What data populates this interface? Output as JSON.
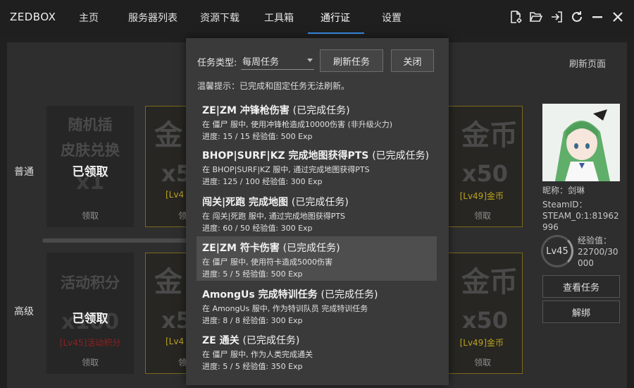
{
  "app": {
    "logo": "ZEDBOX"
  },
  "nav": {
    "items": [
      {
        "label": "主页"
      },
      {
        "label": "服务器列表"
      },
      {
        "label": "资源下载"
      },
      {
        "label": "工具箱"
      },
      {
        "label": "通行证"
      },
      {
        "label": "设置"
      }
    ],
    "active_index": 4
  },
  "window_icons": [
    "file-settings-icon",
    "folder-open-icon",
    "exit-icon",
    "refresh-icon",
    "minimize-icon",
    "close-icon"
  ],
  "background": {
    "refresh_page_label": "刷新页面",
    "rows": [
      {
        "label": "普通"
      },
      {
        "label": "高级"
      }
    ],
    "cards": [
      {
        "big_lines": [
          "随机插",
          "皮肤兑换",
          "x1"
        ],
        "claimed": "已领取",
        "level_text": "",
        "action": "领取"
      },
      {
        "big_lines": [
          "金",
          "x5"
        ],
        "claimed": "",
        "level_text": "[Lv4",
        "action": "领"
      },
      {
        "big_lines": [
          "金币",
          "x50"
        ],
        "claimed": "",
        "level_text": "[Lv49]金币",
        "action": "领取"
      },
      {
        "big_lines": [
          "活动积分",
          "x100"
        ],
        "claimed": "已领取",
        "level_text": "[Lv45]活动积分",
        "action": "领取"
      },
      {
        "big_lines": [
          "金",
          "x5"
        ],
        "claimed": "",
        "level_text": "[Lv4",
        "action": "领"
      },
      {
        "big_lines": [
          "金币",
          "x50"
        ],
        "claimed": "",
        "level_text": "[Lv49]金币",
        "action": "领取"
      }
    ],
    "profile": {
      "nickname_label": "昵称：剑琳",
      "steamid_label": "SteamID：",
      "steamid_value": "STEAM_0:1:81962996",
      "level": "Lv45",
      "exp_label": "经验值：",
      "exp_value": "22700/30000",
      "view_tasks_label": "查看任务",
      "unbind_label": "解绑"
    }
  },
  "popup": {
    "task_type_label": "任务类型:",
    "task_type_value": "每周任务",
    "refresh_tasks_label": "刷新任务",
    "close_label": "关闭",
    "hint": "温馨提示：已完成和固定任务无法刷新。",
    "tasks": [
      {
        "title": "ZE|ZM 冲锋枪伤害",
        "status": "(已完成任务)",
        "desc": "在 僵尸 服中, 使用冲锋枪造成10000伤害 (非升级火力)",
        "progress": "进度: 15 / 15 经验值: 500 Exp"
      },
      {
        "title": "BHOP|SURF|KZ 完成地图获得PTS",
        "status": "(已完成任务)",
        "desc": "在 BHOP|SURF|KZ 服中, 通过完成地图获得PTS",
        "progress": "进度: 125 / 100 经验值: 300 Exp"
      },
      {
        "title": "闯关|死跑 完成地图",
        "status": "(已完成任务)",
        "desc": "在 闯关|死跑 服中, 通过完成地图获得PTS",
        "progress": "进度: 60 / 50 经验值: 300 Exp"
      },
      {
        "title": "ZE|ZM 符卡伤害",
        "status": "(已完成任务)",
        "desc": "在 僵尸 服中, 使用符卡造成5000伤害",
        "progress": "进度: 5 / 5 经验值: 500 Exp"
      },
      {
        "title": "AmongUs 完成特训任务",
        "status": "(已完成任务)",
        "desc": "在 AmongUs 服中, 作为特训队员 完成特训任务",
        "progress": "进度: 8 / 8 经验值: 300 Exp"
      },
      {
        "title": "ZE 通关",
        "status": "(已完成任务)",
        "desc": "在 僵尸 服中, 作为人类完成通关",
        "progress": "进度: 5 / 5 经验值: 350 Exp"
      }
    ],
    "highlighted_index": 3
  }
}
